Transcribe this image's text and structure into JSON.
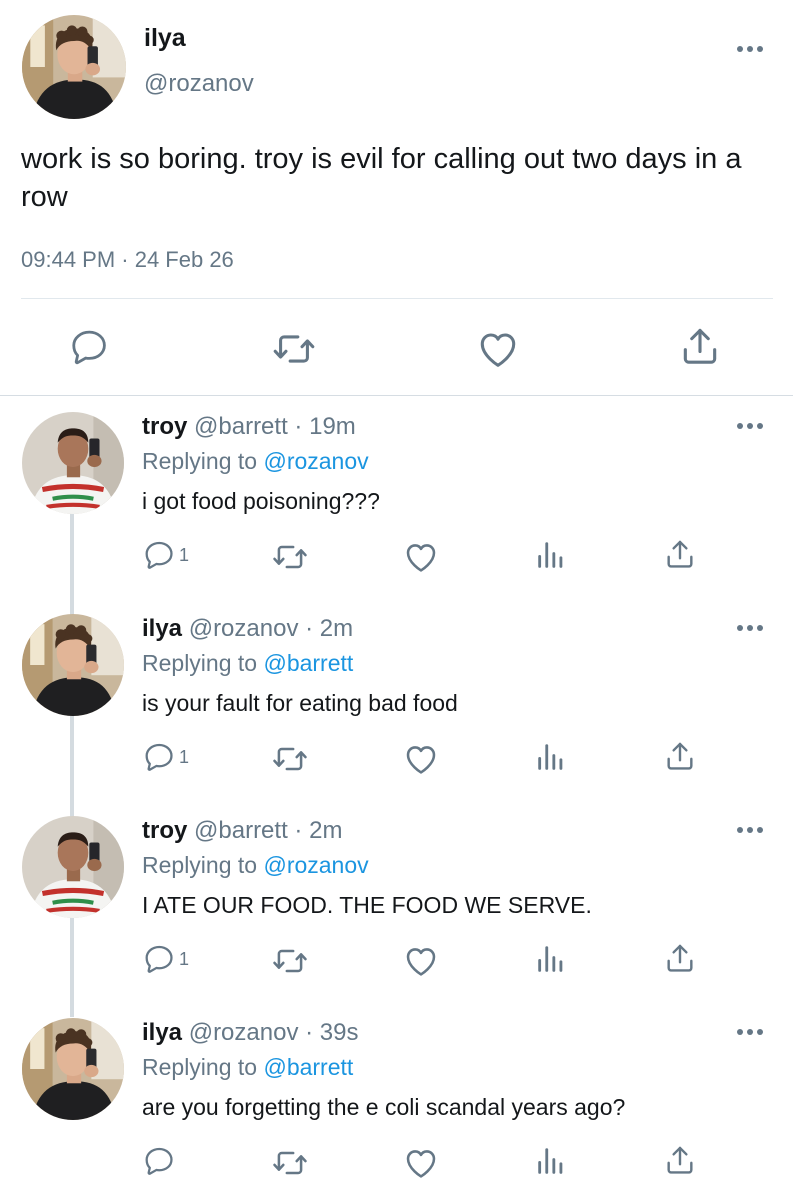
{
  "main_tweet": {
    "name": "ilya",
    "handle": "@rozanov",
    "text": "work is so boring. troy is evil for calling out two days in a row",
    "timestamp": "09:44 PM · 24 Feb 26",
    "actions": [
      "reply-icon",
      "retweet-icon",
      "like-icon",
      "share-icon"
    ]
  },
  "colors": {
    "text": "#14171a",
    "secondary": "#657786",
    "link": "#1b95e0",
    "divider": "#e1e8ed",
    "thread_line": "#d4dbe0"
  },
  "replies": [
    {
      "name": "troy",
      "handle": "@barrett",
      "separator": "·",
      "time": "19m",
      "replying_prefix": "Replying to",
      "replying_to": "@rozanov",
      "text": "i got food poisoning???",
      "reply_count": "1",
      "avatar": "troy-avatar"
    },
    {
      "name": "ilya",
      "handle": "@rozanov",
      "separator": "·",
      "time": "2m",
      "replying_prefix": "Replying to",
      "replying_to": "@barrett",
      "text": "is your fault for eating bad food",
      "reply_count": "1",
      "avatar": "ilya-avatar"
    },
    {
      "name": "troy",
      "handle": "@barrett",
      "separator": "·",
      "time": "2m",
      "replying_prefix": "Replying to",
      "replying_to": "@rozanov",
      "text": "I ATE OUR FOOD. THE FOOD WE SERVE.",
      "reply_count": "1",
      "avatar": "troy-avatar"
    },
    {
      "name": "ilya",
      "handle": "@rozanov",
      "separator": "·",
      "time": "39s",
      "replying_prefix": "Replying to",
      "replying_to": "@barrett",
      "text": "are you forgetting the e coli scandal years ago?",
      "reply_count": "",
      "avatar": "ilya-avatar"
    }
  ]
}
